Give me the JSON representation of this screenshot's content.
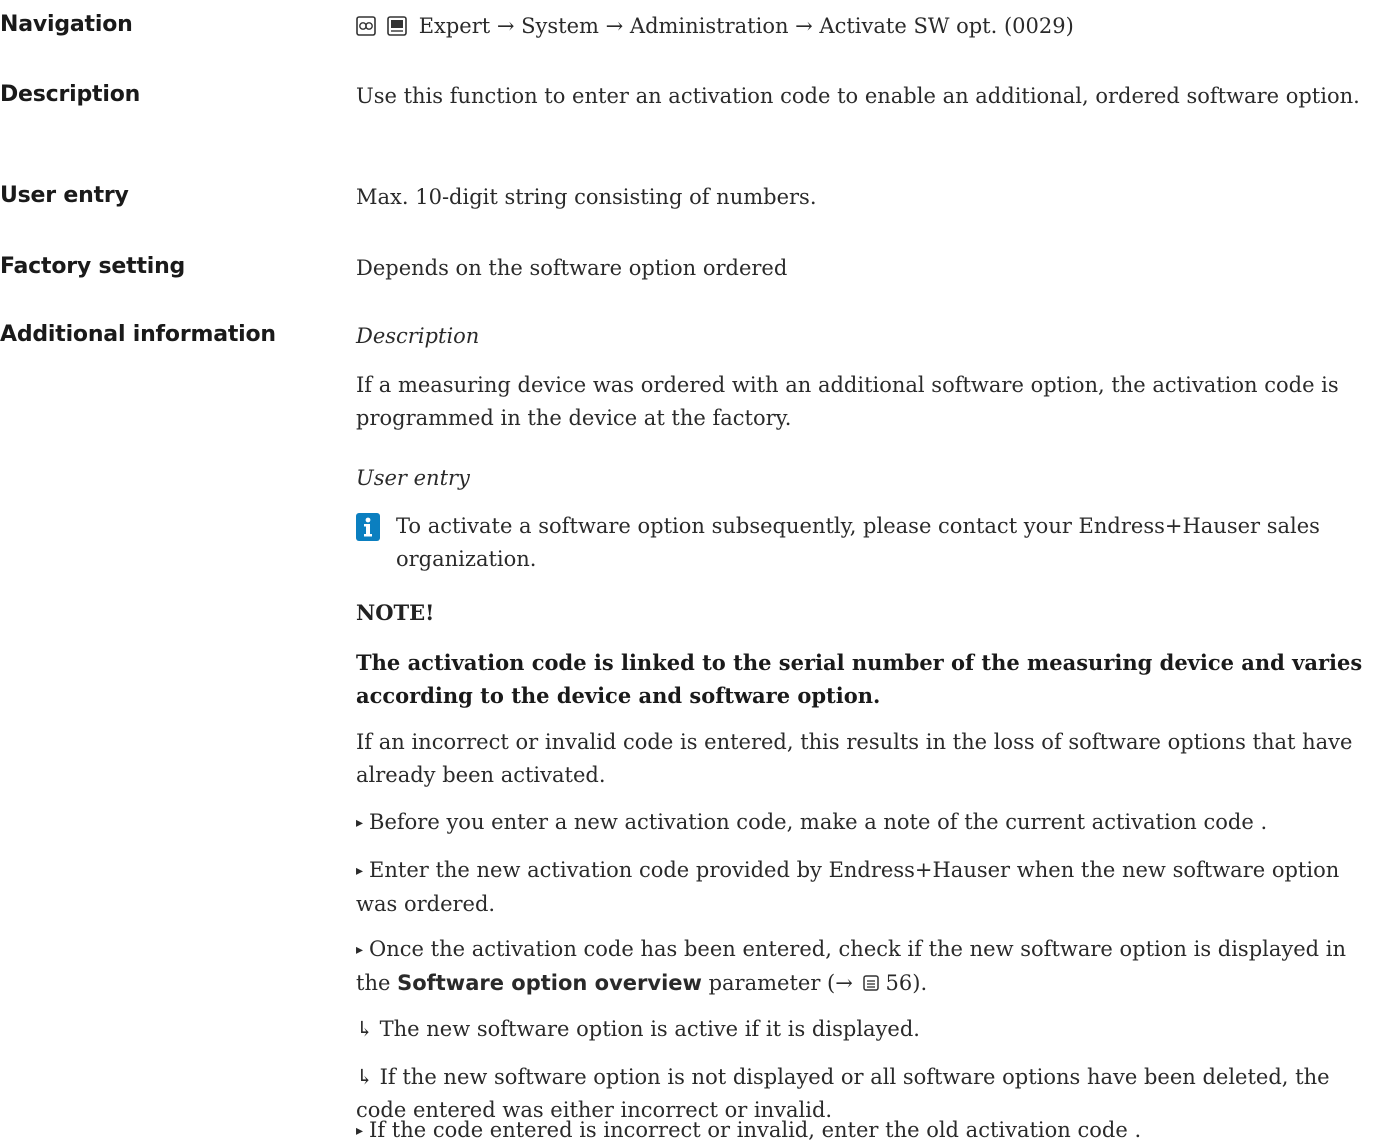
{
  "navigation": {
    "label": "Navigation",
    "path": "Expert → System → Administration → Activate SW opt. (0029)"
  },
  "description": {
    "label": "Description",
    "text": "Use this function to enter an activation code to enable an additional, ordered software option."
  },
  "user_entry": {
    "label": "User entry",
    "text": "Max. 10-digit string consisting of numbers."
  },
  "factory_setting": {
    "label": "Factory setting",
    "text": "Depends on the software option ordered"
  },
  "additional_information": {
    "label": "Additional information",
    "description_heading": "Description",
    "description_text": "If a measuring device was ordered with an additional software option, the activation code is programmed in the device at the factory.",
    "user_entry_heading": "User entry",
    "info_note": "To activate a software option subsequently, please contact your Endress+Hauser sales organization.",
    "notice_heading": "NOTE!",
    "notice_bold": "The activation code is linked to the serial number of the measuring device and varies according to the device and software option.",
    "notice_text": "If an incorrect or invalid code is entered, this results in the loss of software options that have already been activated.",
    "step1": "Before you enter a new activation code, make a note of the current activation code .",
    "step2": "Enter the new activation code provided by Endress+Hauser when the new software option was ordered.",
    "step3_before": "Once the activation code has been entered, check if the new software option is displayed in the ",
    "step3_param": "Software option overview",
    "step3_after": " parameter (→ ",
    "step3_page": "56",
    "step3_end": ").",
    "result1": "The new software option is active if it is displayed.",
    "result2": "If the new software option is not displayed or all software options have been deleted, the code entered was either incorrect or invalid.",
    "step4": "If the code entered is incorrect or invalid, enter the old activation code ."
  },
  "icons": {
    "display_operation": "display-icon",
    "operating_tool": "operating-tool-icon",
    "info": "info-icon",
    "bullet": "▸",
    "result": "↳",
    "page_ref": "page-ref-icon"
  }
}
